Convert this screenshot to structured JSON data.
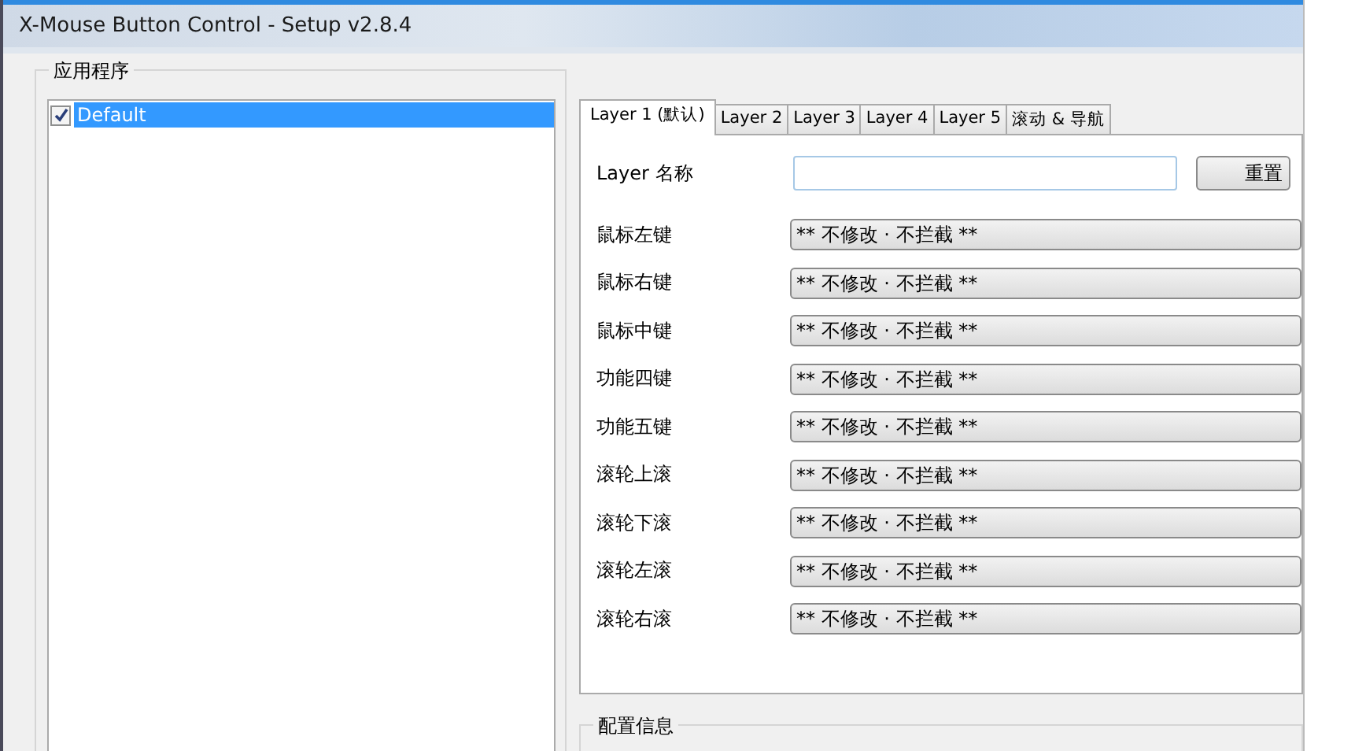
{
  "window": {
    "title": "X-Mouse Button Control - Setup v2.8.4"
  },
  "applications": {
    "title": "应用程序",
    "items": [
      {
        "label": "Default",
        "checked": true,
        "selected": true
      }
    ]
  },
  "tabs": [
    {
      "label": "Layer 1 (默认)",
      "selected": true
    },
    {
      "label": "Layer 2",
      "selected": false
    },
    {
      "label": "Layer 3",
      "selected": false
    },
    {
      "label": "Layer 4",
      "selected": false
    },
    {
      "label": "Layer 5",
      "selected": false
    },
    {
      "label": "滚动 & 导航",
      "selected": false
    }
  ],
  "layer_name": {
    "label": "Layer 名称",
    "button": "重置"
  },
  "mappings": [
    {
      "label": "鼠标左键",
      "value": "** 不修改 · 不拦截 **"
    },
    {
      "label": "鼠标右键",
      "value": "** 不修改 · 不拦截 **"
    },
    {
      "label": "鼠标中键",
      "value": "** 不修改 · 不拦截 **"
    },
    {
      "label": "功能四键",
      "value": "** 不修改 · 不拦截 **"
    },
    {
      "label": "功能五键",
      "value": "** 不修改 · 不拦截 **"
    },
    {
      "label": "滚轮上滚",
      "value": "** 不修改 · 不拦截 **"
    },
    {
      "label": "滚轮下滚",
      "value": "** 不修改 · 不拦截 **"
    },
    {
      "label": "滚轮左滚",
      "value": "** 不修改 · 不拦截 **"
    },
    {
      "label": "滚轮右滚",
      "value": "** 不修改 · 不拦截 **"
    }
  ],
  "config_info": {
    "title": "配置信息"
  }
}
